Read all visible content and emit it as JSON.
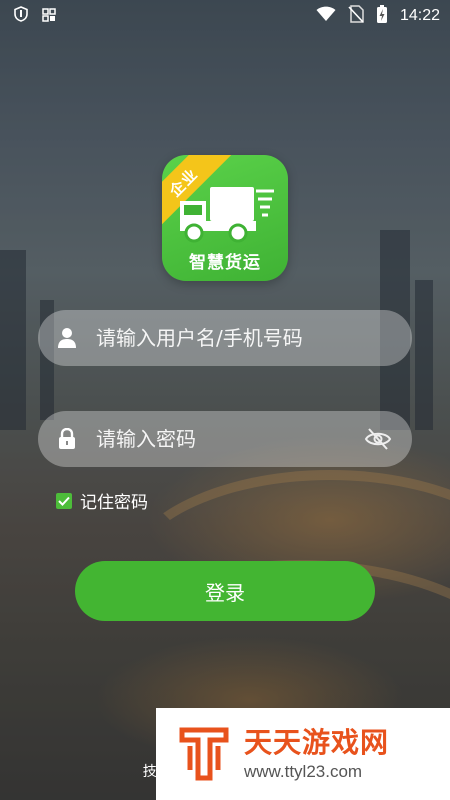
{
  "status_bar": {
    "time": "14:22",
    "left_icons": [
      "shield-icon",
      "grid-icon"
    ],
    "right_icons": [
      "wifi-icon",
      "no-sim-icon",
      "battery-charging-icon"
    ]
  },
  "app_logo": {
    "badge": "企业",
    "name": "智慧货运",
    "colors": {
      "green": "#43b532",
      "badge": "#f4c51a"
    }
  },
  "login_form": {
    "username_placeholder": "请输入用户名/手机号码",
    "password_placeholder": "请输入密码",
    "remember_password_label": "记住密码",
    "remember_password_checked": true,
    "login_button_label": "登录"
  },
  "footer": {
    "copyright_fragment": "版权",
    "tech_support_fragment": "技术支持 ©"
  },
  "watermark": {
    "site_name": "天天游戏网",
    "url": "www.ttyl23.com",
    "accent_color": "#e8521c"
  }
}
